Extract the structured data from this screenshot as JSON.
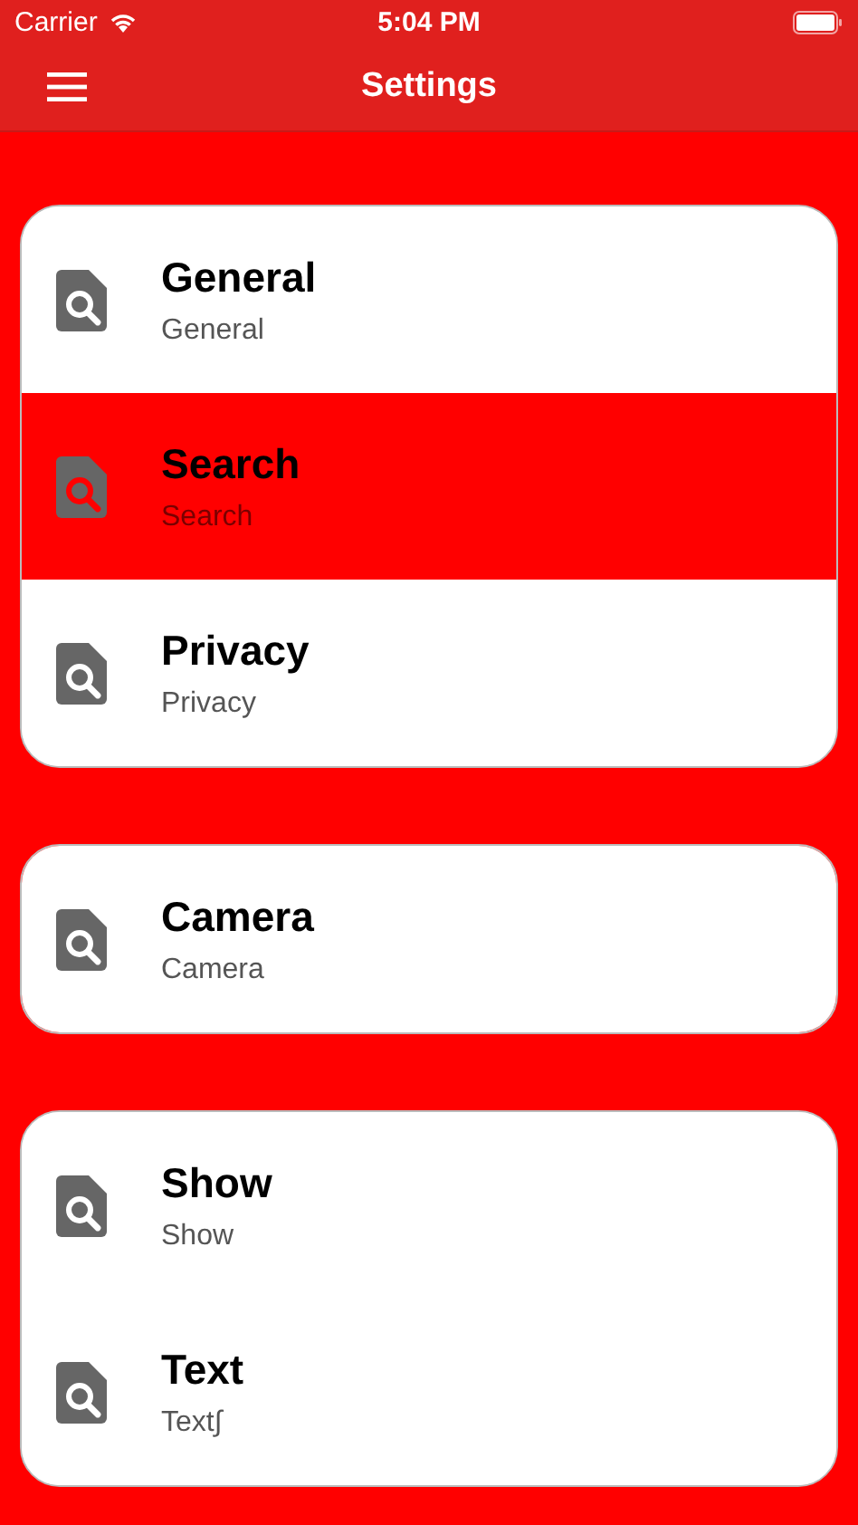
{
  "status_bar": {
    "carrier": "Carrier",
    "time": "5:04 PM"
  },
  "nav_bar": {
    "title": "Settings"
  },
  "groups": [
    {
      "items": [
        {
          "title": "General",
          "subtitle": "General",
          "selected": false
        },
        {
          "title": "Search",
          "subtitle": "Search",
          "selected": true
        },
        {
          "title": "Privacy",
          "subtitle": "Privacy",
          "selected": false
        }
      ]
    },
    {
      "items": [
        {
          "title": "Camera",
          "subtitle": "Camera",
          "selected": false
        }
      ]
    },
    {
      "items": [
        {
          "title": "Show",
          "subtitle": "Show",
          "selected": false
        },
        {
          "title": "Text",
          "subtitle": "Text∫",
          "selected": false
        }
      ]
    }
  ]
}
